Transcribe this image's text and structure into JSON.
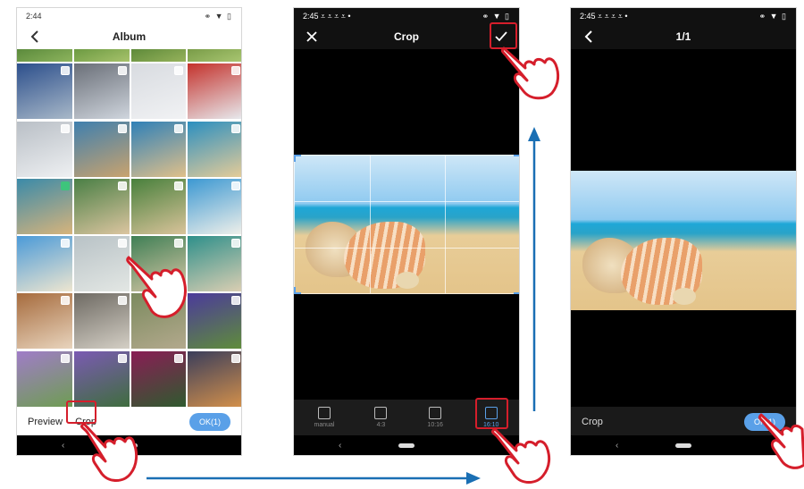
{
  "screen1": {
    "status_time": "2:44",
    "status_icons": "⚭ ▼ ▯",
    "back_icon": "chevron-left-icon",
    "title": "Album",
    "preview_label": "Preview",
    "crop_label": "Crop",
    "ok_label": "OK(1)",
    "photos": [
      {
        "c1": "#5b8a3c",
        "c2": "#8db45d",
        "checked": false
      },
      {
        "c1": "#6c9a42",
        "c2": "#a7c26b",
        "checked": false
      },
      {
        "c1": "#5e8a3a",
        "c2": "#96b25b",
        "checked": false
      },
      {
        "c1": "#799c48",
        "c2": "#a9c671",
        "checked": false
      },
      {
        "c1": "#2c4f8c",
        "c2": "#a8b8c8",
        "checked": false
      },
      {
        "c1": "#6a6f78",
        "c2": "#cfd5dd",
        "checked": false
      },
      {
        "c1": "#d8dbe0",
        "c2": "#f1f2f4",
        "checked": false
      },
      {
        "c1": "#c4322c",
        "c2": "#e7eaee",
        "checked": false
      },
      {
        "c1": "#b9bfc6",
        "c2": "#eef0f2",
        "checked": false
      },
      {
        "c1": "#3f7fae",
        "c2": "#c9a36e",
        "checked": false
      },
      {
        "c1": "#2f80b8",
        "c2": "#e0c08a",
        "checked": false
      },
      {
        "c1": "#2c8fc0",
        "c2": "#e6cc98",
        "checked": false
      },
      {
        "c1": "#3a8aa9",
        "c2": "#d7b47c",
        "checked": true
      },
      {
        "c1": "#4a7f45",
        "c2": "#dcc5a0",
        "checked": false
      },
      {
        "c1": "#48803c",
        "c2": "#d9c39a",
        "checked": false
      },
      {
        "c1": "#3c98d2",
        "c2": "#f0f0ea",
        "checked": false
      },
      {
        "c1": "#4b9ad8",
        "c2": "#eee6d0",
        "checked": false
      },
      {
        "c1": "#b8c2c6",
        "c2": "#e3e7e4",
        "checked": false
      },
      {
        "c1": "#3f7f55",
        "c2": "#d8c7a6",
        "checked": false
      },
      {
        "c1": "#2e8f8a",
        "c2": "#dccfb3",
        "checked": false
      },
      {
        "c1": "#a66b3d",
        "c2": "#e8d4bd",
        "checked": false
      },
      {
        "c1": "#6e6a63",
        "c2": "#d4cfc5",
        "checked": false
      },
      {
        "c1": "#7b8a5e",
        "c2": "#b3a98d",
        "checked": false
      },
      {
        "c1": "#4b3a9b",
        "c2": "#5f8d3a",
        "checked": false
      },
      {
        "c1": "#a07cc8",
        "c2": "#6e9d52",
        "checked": false
      },
      {
        "c1": "#7b5ab3",
        "c2": "#3f6d3e",
        "checked": false
      },
      {
        "c1": "#8a1d55",
        "c2": "#2f5a2f",
        "checked": false
      },
      {
        "c1": "#3b3e5b",
        "c2": "#d3904b",
        "checked": false
      }
    ]
  },
  "screen2": {
    "status_time": "2:45 ⩡ ⩡ ⩡ ⩡ •",
    "status_icons": "⚭ ▼ ▯",
    "close_icon": "close-icon",
    "title": "Crop",
    "confirm_icon": "check-icon",
    "ratios": [
      {
        "label": "manual",
        "icon": "crop-manual-icon",
        "active": false
      },
      {
        "label": "4:3",
        "icon": "ratio-4-3-icon",
        "active": false
      },
      {
        "label": "10:16",
        "icon": "ratio-10-16-icon",
        "active": false
      },
      {
        "label": "16:10",
        "icon": "ratio-16-10-icon",
        "active": true
      }
    ]
  },
  "screen3": {
    "status_time": "2:45 ⩡ ⩡ ⩡ ⩡ •",
    "status_icons": "⚭ ▼ ▯",
    "back_icon": "chevron-left-icon",
    "title": "1/1",
    "crop_label": "Crop",
    "ok_label": "OK(1)"
  },
  "colors": {
    "accent": "#5aa0e8",
    "highlight": "#d51e2b",
    "arrow": "#1a6fb4"
  }
}
